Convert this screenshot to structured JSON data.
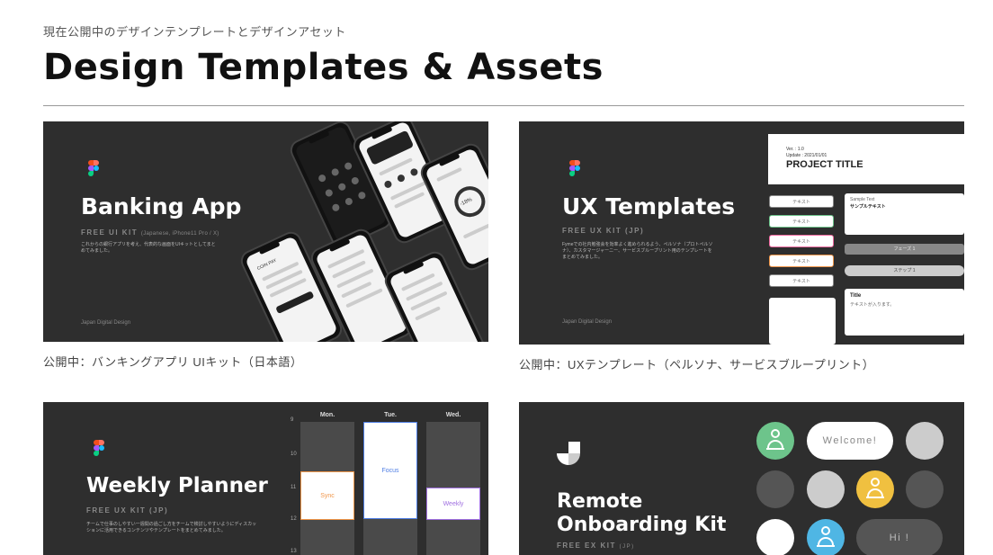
{
  "header": {
    "eyebrow": "現在公開中のデザインテンプレートとデザインアセット",
    "title": "Design Templates & Assets"
  },
  "cards": [
    {
      "caption": "公開中：バンキングアプリ UIキット（日本語）",
      "thumb": {
        "title": "Banking App",
        "kit": "FREE UI KIT",
        "kit_sub": "(Japanese, iPhone11 Pro / X)",
        "desc": "これからの銀行アプリを考え、代表的な画面をUIキットとしてまとめてみました。",
        "footer": "Japan Digital Design",
        "screen_label": "COIN PAY",
        "amount": "-18%"
      }
    },
    {
      "caption": "公開中：UXテンプレート（ペルソナ、サービスブループリント）",
      "thumb": {
        "title": "UX Templates",
        "kit": "FREE UX KIT (JP)",
        "desc": "Fymeでの社内勉強会を効率よく進められるよう、ペルソナ（プロトペルソナ）、カスタマージャーニー、サービスブループリント用のテンプレートをまとめてみました。",
        "footer": "Japan Digital Design",
        "panel_meta_1": "Ver. : 1.0",
        "panel_meta_2": "Update : 2021/01/01",
        "panel_title": "PROJECT TITLE",
        "chip_label": "テキスト",
        "sample_label": "Sample Text",
        "sample_value": "サンプルテキスト",
        "pill_1": "フェーズ 1",
        "pill_2": "ステップ 1",
        "box_title": "Title",
        "box_text": "テキストが入ります。"
      }
    },
    {
      "caption": "",
      "thumb": {
        "title": "Weekly Planner",
        "kit": "FREE UX KIT (JP)",
        "desc": "チームで仕事のしやすい一週間の過ごし方をチームで検討しやすいようにディスカッションに活用できるコンテンツやテンプレートをまとめてみました。",
        "days": [
          "Mon.",
          "Tue.",
          "Wed."
        ],
        "hours": [
          "9",
          "10",
          "11",
          "12",
          "13"
        ],
        "events": [
          "Sync",
          "Focus",
          "Weekly"
        ]
      }
    },
    {
      "caption": "",
      "thumb": {
        "title_1": "Remote",
        "title_2": "Onboarding Kit",
        "kit": "FREE EX KIT",
        "kit_sub": "(JP)",
        "pill_1": "Welcome!",
        "pill_2": "Hi !"
      }
    }
  ],
  "colors": {
    "thumb_bg": "#2e2e2e",
    "green": "#6dc48b",
    "yellow": "#f0c040",
    "blue": "#4fb6e4",
    "orange": "#f0964a",
    "purple": "#a070e0",
    "pink": "#f06aa0"
  }
}
